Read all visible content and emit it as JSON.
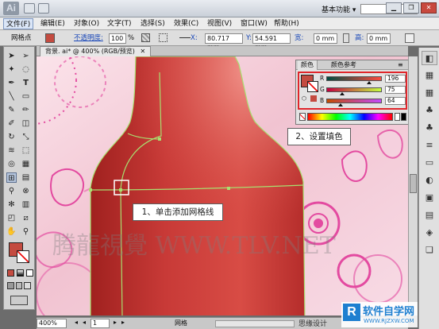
{
  "app": {
    "logo": "Ai",
    "workspace_label": "基本功能",
    "workspace_arrow": "▾"
  },
  "window_controls": {
    "minimize": "▁",
    "restore": "❐",
    "close": "✕"
  },
  "menu": [
    "文件(F)",
    "编辑(E)",
    "对象(O)",
    "文字(T)",
    "选择(S)",
    "效果(C)",
    "视图(V)",
    "窗口(W)",
    "帮助(H)"
  ],
  "control_bar": {
    "tool_name": "网格点",
    "opacity_label": "不透明度:",
    "opacity_value": "100",
    "opacity_unit": "%",
    "x_label": "X:",
    "x_value": "80.717 mm",
    "y_label": "Y:",
    "y_value": "54.591 mm",
    "w_label": "宽:",
    "w_value": "0 mm",
    "h_label": "高:",
    "h_value": "0 mm"
  },
  "document_tab": {
    "title": "背景. ai* @ 400% (RGB/预览)",
    "close": "✕"
  },
  "color_panel": {
    "tabs": [
      "颜色",
      "颜色参考"
    ],
    "channels": [
      {
        "name": "R",
        "value": "196",
        "fraction": 0.77
      },
      {
        "name": "G",
        "value": "75",
        "fraction": 0.29
      },
      {
        "name": "B",
        "value": "64",
        "fraction": 0.25
      }
    ],
    "fill_color": "#c44b40",
    "gradient_colors": [
      "#ff0000",
      "#ffff00",
      "#00ff00",
      "#00ffff",
      "#0000ff",
      "#ff00ff",
      "#ff0000"
    ]
  },
  "callouts": {
    "set_fill": "2、设置填色",
    "add_mesh": "1、单击添加网格线"
  },
  "watermark": {
    "text": "腾龍視覺 WWW.TLV.NET",
    "site_text": "思缘设计"
  },
  "logo_badge": {
    "text": "软件自学网",
    "url": "WWW.RJZXW.COM"
  },
  "status_bar": {
    "zoom": "400%",
    "page": "1",
    "tool": "网格"
  },
  "artwork": {
    "bottle_color": "#c73d3a",
    "background_color": "#f2c6d3",
    "accent_pink": "#e34aa0",
    "mesh_line": "#a8e070"
  }
}
